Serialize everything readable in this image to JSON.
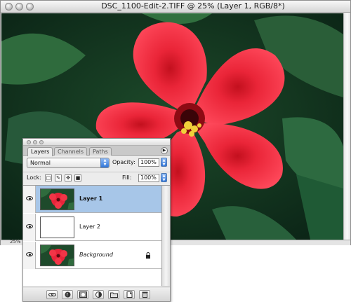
{
  "document": {
    "title": "DSC_1100-Edit-2.TIFF @ 25% (Layer 1, RGB/8*)",
    "zoom": "25%"
  },
  "layers_panel": {
    "tabs": [
      {
        "label": "Layers",
        "active": true
      },
      {
        "label": "Channels",
        "active": false
      },
      {
        "label": "Paths",
        "active": false
      }
    ],
    "blend_mode": "Normal",
    "opacity_label": "Opacity:",
    "opacity_value": "100%",
    "lock_label": "Lock:",
    "fill_label": "Fill:",
    "fill_value": "100%",
    "layers": [
      {
        "name": "Layer 1",
        "selected": true,
        "visible": true,
        "thumbnail": "hibiscus-flower"
      },
      {
        "name": "Layer 2",
        "selected": false,
        "visible": true,
        "thumbnail": "blank-white"
      },
      {
        "name": "Background",
        "selected": false,
        "visible": true,
        "thumbnail": "hibiscus-flower",
        "locked": true
      }
    ],
    "footer_buttons": [
      "link-icon",
      "layer-style-icon",
      "layer-mask-icon",
      "adjustment-layer-icon",
      "new-group-icon",
      "new-layer-icon",
      "trash-icon"
    ]
  },
  "colors": {
    "selection_highlight": "#a7c6e8",
    "flower_red": "#e8243a",
    "leaf_green": "#1f4f2c",
    "aqua_blue": "#2f75d8"
  }
}
